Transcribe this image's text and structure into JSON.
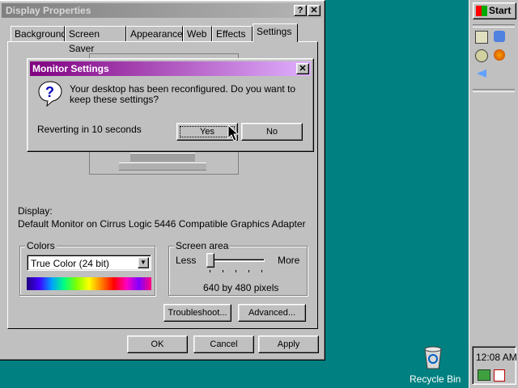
{
  "display_properties": {
    "title": "Display Properties",
    "help_button": "?",
    "close_button": "✕",
    "tabs": [
      "Background",
      "Screen Saver",
      "Appearance",
      "Web",
      "Effects",
      "Settings"
    ],
    "active_tab": "Settings",
    "display_label": "Display:",
    "display_value": "Default Monitor on Cirrus Logic 5446 Compatible Graphics Adapter",
    "colors": {
      "group_label": "Colors",
      "selected": "True Color (24 bit)"
    },
    "screen_area": {
      "group_label": "Screen area",
      "less_label": "Less",
      "more_label": "More",
      "value_text": "640 by 480 pixels",
      "slider_position": 0
    },
    "troubleshoot_button": "Troubleshoot...",
    "advanced_button": "Advanced...",
    "ok_button": "OK",
    "cancel_button": "Cancel",
    "apply_button": "Apply"
  },
  "monitor_settings": {
    "title": "Monitor Settings",
    "close_button": "✕",
    "message": "Your desktop has been reconfigured.  Do you want to keep these settings?",
    "countdown": "Reverting in 10 seconds",
    "yes_button": "Yes",
    "no_button": "No",
    "icon": "question-icon"
  },
  "taskbar": {
    "start_label": "Start",
    "quick_launch_icons": [
      "show-desktop-icon",
      "internet-explorer-icon",
      "search-icon",
      "firefox-icon",
      "outlook-express-icon"
    ],
    "clock": "12:08 AM",
    "tray_icons": [
      "network-icon",
      "acrobat-icon"
    ]
  },
  "desktop": {
    "recycle_bin_label": "Recycle Bin"
  },
  "colors": {
    "desktop": "#008080",
    "active_title": "#800080",
    "inactive_title": "#808080",
    "face": "#c0c0c0"
  }
}
